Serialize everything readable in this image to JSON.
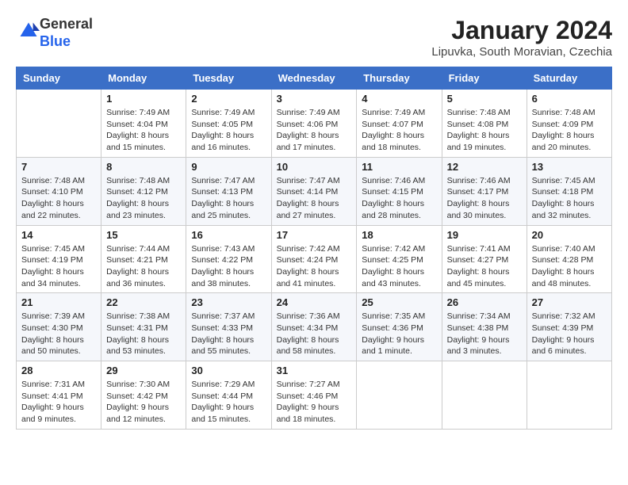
{
  "header": {
    "logo_general": "General",
    "logo_blue": "Blue",
    "month_title": "January 2024",
    "location": "Lipuvka, South Moravian, Czechia"
  },
  "columns": [
    "Sunday",
    "Monday",
    "Tuesday",
    "Wednesday",
    "Thursday",
    "Friday",
    "Saturday"
  ],
  "weeks": [
    [
      {
        "day": "",
        "info": ""
      },
      {
        "day": "1",
        "info": "Sunrise: 7:49 AM\nSunset: 4:04 PM\nDaylight: 8 hours\nand 15 minutes."
      },
      {
        "day": "2",
        "info": "Sunrise: 7:49 AM\nSunset: 4:05 PM\nDaylight: 8 hours\nand 16 minutes."
      },
      {
        "day": "3",
        "info": "Sunrise: 7:49 AM\nSunset: 4:06 PM\nDaylight: 8 hours\nand 17 minutes."
      },
      {
        "day": "4",
        "info": "Sunrise: 7:49 AM\nSunset: 4:07 PM\nDaylight: 8 hours\nand 18 minutes."
      },
      {
        "day": "5",
        "info": "Sunrise: 7:48 AM\nSunset: 4:08 PM\nDaylight: 8 hours\nand 19 minutes."
      },
      {
        "day": "6",
        "info": "Sunrise: 7:48 AM\nSunset: 4:09 PM\nDaylight: 8 hours\nand 20 minutes."
      }
    ],
    [
      {
        "day": "7",
        "info": "Sunrise: 7:48 AM\nSunset: 4:10 PM\nDaylight: 8 hours\nand 22 minutes."
      },
      {
        "day": "8",
        "info": "Sunrise: 7:48 AM\nSunset: 4:12 PM\nDaylight: 8 hours\nand 23 minutes."
      },
      {
        "day": "9",
        "info": "Sunrise: 7:47 AM\nSunset: 4:13 PM\nDaylight: 8 hours\nand 25 minutes."
      },
      {
        "day": "10",
        "info": "Sunrise: 7:47 AM\nSunset: 4:14 PM\nDaylight: 8 hours\nand 27 minutes."
      },
      {
        "day": "11",
        "info": "Sunrise: 7:46 AM\nSunset: 4:15 PM\nDaylight: 8 hours\nand 28 minutes."
      },
      {
        "day": "12",
        "info": "Sunrise: 7:46 AM\nSunset: 4:17 PM\nDaylight: 8 hours\nand 30 minutes."
      },
      {
        "day": "13",
        "info": "Sunrise: 7:45 AM\nSunset: 4:18 PM\nDaylight: 8 hours\nand 32 minutes."
      }
    ],
    [
      {
        "day": "14",
        "info": "Sunrise: 7:45 AM\nSunset: 4:19 PM\nDaylight: 8 hours\nand 34 minutes."
      },
      {
        "day": "15",
        "info": "Sunrise: 7:44 AM\nSunset: 4:21 PM\nDaylight: 8 hours\nand 36 minutes."
      },
      {
        "day": "16",
        "info": "Sunrise: 7:43 AM\nSunset: 4:22 PM\nDaylight: 8 hours\nand 38 minutes."
      },
      {
        "day": "17",
        "info": "Sunrise: 7:42 AM\nSunset: 4:24 PM\nDaylight: 8 hours\nand 41 minutes."
      },
      {
        "day": "18",
        "info": "Sunrise: 7:42 AM\nSunset: 4:25 PM\nDaylight: 8 hours\nand 43 minutes."
      },
      {
        "day": "19",
        "info": "Sunrise: 7:41 AM\nSunset: 4:27 PM\nDaylight: 8 hours\nand 45 minutes."
      },
      {
        "day": "20",
        "info": "Sunrise: 7:40 AM\nSunset: 4:28 PM\nDaylight: 8 hours\nand 48 minutes."
      }
    ],
    [
      {
        "day": "21",
        "info": "Sunrise: 7:39 AM\nSunset: 4:30 PM\nDaylight: 8 hours\nand 50 minutes."
      },
      {
        "day": "22",
        "info": "Sunrise: 7:38 AM\nSunset: 4:31 PM\nDaylight: 8 hours\nand 53 minutes."
      },
      {
        "day": "23",
        "info": "Sunrise: 7:37 AM\nSunset: 4:33 PM\nDaylight: 8 hours\nand 55 minutes."
      },
      {
        "day": "24",
        "info": "Sunrise: 7:36 AM\nSunset: 4:34 PM\nDaylight: 8 hours\nand 58 minutes."
      },
      {
        "day": "25",
        "info": "Sunrise: 7:35 AM\nSunset: 4:36 PM\nDaylight: 9 hours\nand 1 minute."
      },
      {
        "day": "26",
        "info": "Sunrise: 7:34 AM\nSunset: 4:38 PM\nDaylight: 9 hours\nand 3 minutes."
      },
      {
        "day": "27",
        "info": "Sunrise: 7:32 AM\nSunset: 4:39 PM\nDaylight: 9 hours\nand 6 minutes."
      }
    ],
    [
      {
        "day": "28",
        "info": "Sunrise: 7:31 AM\nSunset: 4:41 PM\nDaylight: 9 hours\nand 9 minutes."
      },
      {
        "day": "29",
        "info": "Sunrise: 7:30 AM\nSunset: 4:42 PM\nDaylight: 9 hours\nand 12 minutes."
      },
      {
        "day": "30",
        "info": "Sunrise: 7:29 AM\nSunset: 4:44 PM\nDaylight: 9 hours\nand 15 minutes."
      },
      {
        "day": "31",
        "info": "Sunrise: 7:27 AM\nSunset: 4:46 PM\nDaylight: 9 hours\nand 18 minutes."
      },
      {
        "day": "",
        "info": ""
      },
      {
        "day": "",
        "info": ""
      },
      {
        "day": "",
        "info": ""
      }
    ]
  ]
}
